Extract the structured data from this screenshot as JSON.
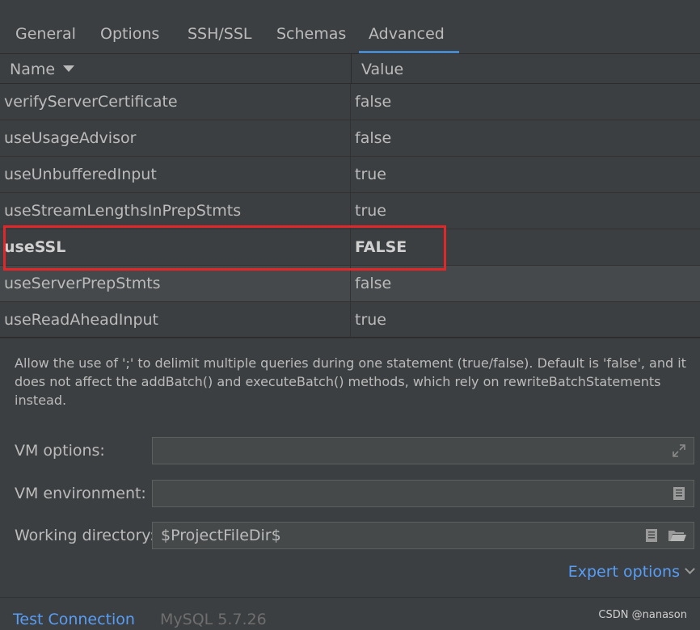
{
  "tabs": [
    {
      "label": "General"
    },
    {
      "label": "Options"
    },
    {
      "label": "SSH/SSL"
    },
    {
      "label": "Schemas"
    },
    {
      "label": "Advanced",
      "active": true
    }
  ],
  "table": {
    "headers": {
      "name": "Name",
      "value": "Value"
    },
    "rows": [
      {
        "name": "verifyServerCertificate",
        "value": "false"
      },
      {
        "name": "useUsageAdvisor",
        "value": "false"
      },
      {
        "name": "useUnbufferedInput",
        "value": "true"
      },
      {
        "name": "useStreamLengthsInPrepStmts",
        "value": "true"
      },
      {
        "name": "useSSL",
        "value": "FALSE",
        "modified": true
      },
      {
        "name": "useServerPrepStmts",
        "value": "false",
        "selected": true
      },
      {
        "name": "useReadAheadInput",
        "value": "true"
      }
    ]
  },
  "description": "Allow the use of ';' to delimit multiple queries during one statement (true/false). Default is 'false', and it does not affect the addBatch() and executeBatch() methods, which rely on rewriteBatchStatements instead.",
  "form": {
    "vm_options": {
      "label": "VM options:",
      "value": ""
    },
    "vm_environment": {
      "label": "VM environment:",
      "value": ""
    },
    "working_directory": {
      "label": "Working directory:",
      "value": "$ProjectFileDir$"
    }
  },
  "expert_options": "Expert options",
  "footer": {
    "test_connection": "Test Connection",
    "driver_version": "MySQL 5.7.26",
    "watermark": "CSDN @nanason"
  },
  "colors": {
    "background": "#3c3f41",
    "accent": "#4a88c7",
    "link": "#589df6",
    "highlight_box": "#e0272a"
  }
}
